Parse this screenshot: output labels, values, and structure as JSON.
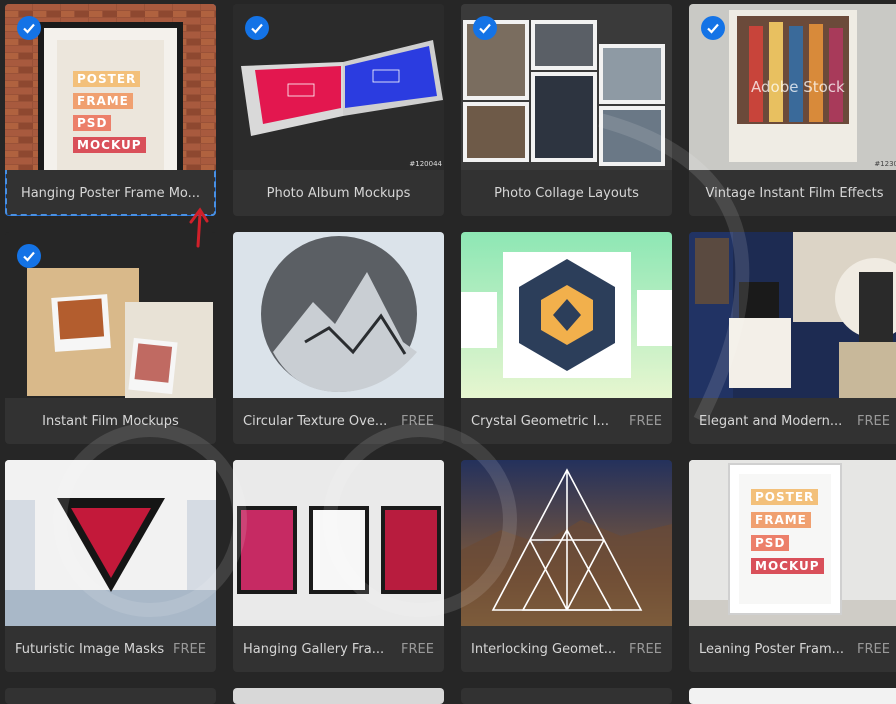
{
  "templates": [
    {
      "title": "Hanging Poster Frame Mo...",
      "free": "",
      "selected": true,
      "poster_lines": [
        "POSTER",
        "FRAME",
        "PSD",
        "MOCKUP"
      ]
    },
    {
      "title": "Photo Album Mockups",
      "free": "",
      "selected": true,
      "stock_id": "#120044"
    },
    {
      "title": "Photo Collage Layouts",
      "free": "",
      "selected": true
    },
    {
      "title": "Vintage Instant Film Effects",
      "free": "",
      "selected": true,
      "watermark": "Adobe Stock",
      "stock_id": "#1230"
    },
    {
      "title": "Instant Film Mockups",
      "free": "",
      "selected": true
    },
    {
      "title": "Circular Texture Ove...",
      "free": "FREE",
      "selected": false
    },
    {
      "title": "Crystal Geometric I...",
      "free": "FREE",
      "selected": false
    },
    {
      "title": "Elegant and Modern...",
      "free": "FREE",
      "selected": false
    },
    {
      "title": "Futuristic Image Masks",
      "free": "FREE",
      "selected": false
    },
    {
      "title": "Hanging Gallery Fra...",
      "free": "FREE",
      "selected": false
    },
    {
      "title": "Interlocking Geomet...",
      "free": "FREE",
      "selected": false
    },
    {
      "title": "Leaning Poster Fram...",
      "free": "FREE",
      "selected": false,
      "poster_lines": [
        "POSTER",
        "FRAME",
        "PSD",
        "MOCKUP"
      ]
    }
  ],
  "colors": {
    "accent": "#1473e6",
    "card_bg": "#323232",
    "page_bg": "#262626"
  }
}
